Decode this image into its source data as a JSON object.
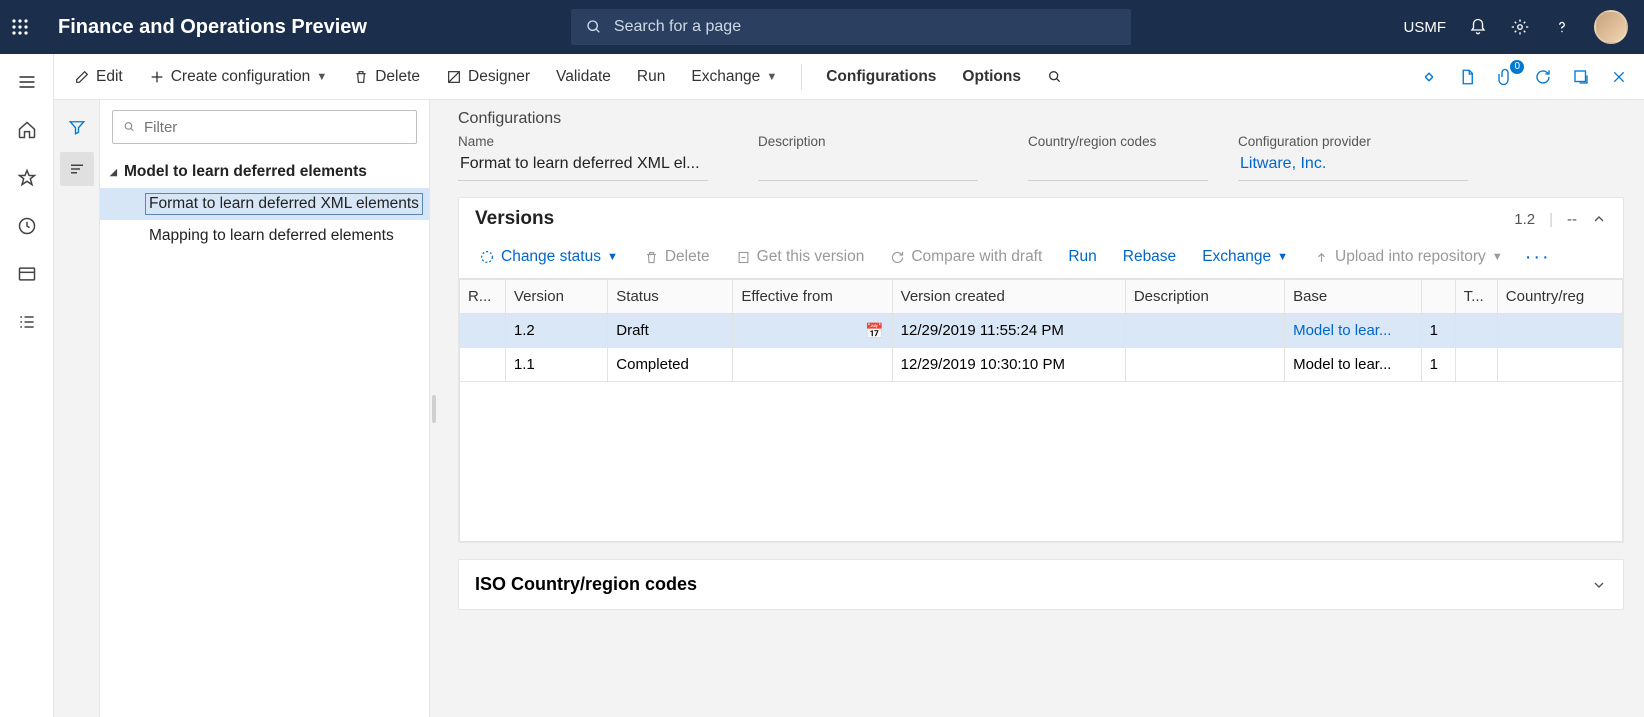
{
  "topbar": {
    "title": "Finance and Operations Preview",
    "search_placeholder": "Search for a page",
    "company": "USMF"
  },
  "actionbar": {
    "edit": "Edit",
    "create": "Create configuration",
    "delete": "Delete",
    "designer": "Designer",
    "validate": "Validate",
    "run": "Run",
    "exchange": "Exchange",
    "configurations": "Configurations",
    "options": "Options",
    "attach_badge": "0"
  },
  "tree": {
    "filter_placeholder": "Filter",
    "root": "Model to learn deferred elements",
    "children": [
      "Format to learn deferred XML elements",
      "Mapping to learn deferred elements"
    ],
    "selected_index": 0
  },
  "detail": {
    "section": "Configurations",
    "labels": {
      "name": "Name",
      "description": "Description",
      "country": "Country/region codes",
      "provider": "Configuration provider"
    },
    "name": "Format to learn deferred XML el...",
    "description": "",
    "country": "",
    "provider": "Litware, Inc."
  },
  "versions": {
    "title": "Versions",
    "header_value": "1.2",
    "header_dash": "--",
    "toolbar": {
      "change_status": "Change status",
      "delete": "Delete",
      "get": "Get this version",
      "compare": "Compare with draft",
      "run": "Run",
      "rebase": "Rebase",
      "exchange": "Exchange",
      "upload": "Upload into repository"
    },
    "columns": [
      "R...",
      "Version",
      "Status",
      "Effective from",
      "Version created",
      "Description",
      "Base",
      "",
      "T...",
      "Country/reg"
    ],
    "rows": [
      {
        "r": "",
        "version": "1.2",
        "status": "Draft",
        "effective": "",
        "created": "12/29/2019 11:55:24 PM",
        "description": "",
        "base": "Model to lear...",
        "basenum": "1",
        "t": "",
        "cr": "",
        "selected": true
      },
      {
        "r": "",
        "version": "1.1",
        "status": "Completed",
        "effective": "",
        "created": "12/29/2019 10:30:10 PM",
        "description": "",
        "base": "Model to lear...",
        "basenum": "1",
        "t": "",
        "cr": "",
        "selected": false
      }
    ]
  },
  "iso": {
    "title": "ISO Country/region codes"
  }
}
